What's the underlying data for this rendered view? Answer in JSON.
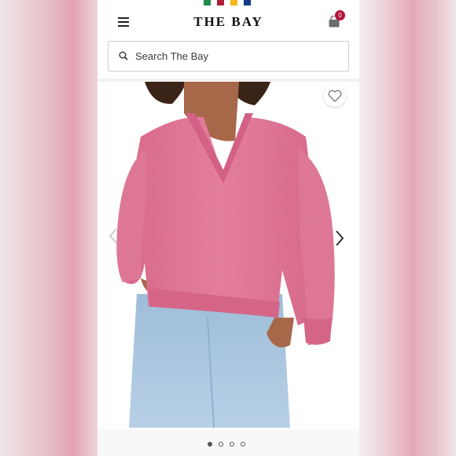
{
  "header": {
    "logo_text": "THE BAY",
    "cart_count": "0",
    "stripe_colors": [
      "#1f8a4c",
      "#b11e3a",
      "#f3b81c",
      "#123c8c"
    ]
  },
  "search": {
    "placeholder": "Search The Bay"
  },
  "icons": {
    "menu": "hamburger-menu-icon",
    "cart": "shopping-bag-icon",
    "search": "search-icon",
    "wishlist": "heart-icon",
    "prev": "chevron-left-icon",
    "next": "chevron-right-icon"
  },
  "product_image": {
    "subject": "pink v-neck knit sweater with light blue jeans"
  },
  "carousel": {
    "total_slides": 4,
    "active_index": 0
  },
  "colors": {
    "accent_badge": "#b5123a",
    "sweater": "#e27a98",
    "jeans": "#a8c6df"
  }
}
